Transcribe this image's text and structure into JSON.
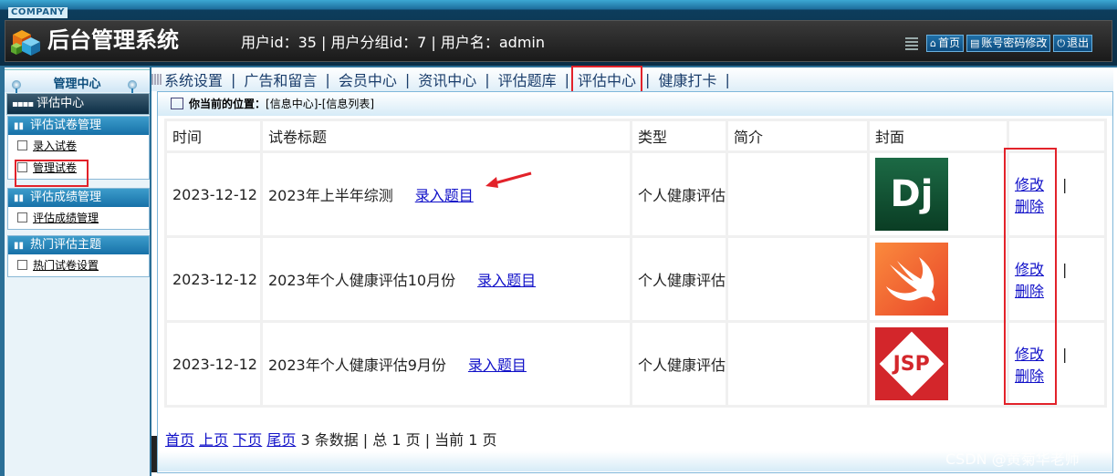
{
  "header": {
    "company": "COMPANY",
    "title": "后台管理系统",
    "user_info": "用户id：35 | 用户分组id：7 | 用户名：admin",
    "buttons": [
      {
        "label": "首页",
        "icon": "home-icon"
      },
      {
        "label": "账号密码修改",
        "icon": "list-icon"
      },
      {
        "label": "退出",
        "icon": "power-icon"
      }
    ]
  },
  "sidebar": {
    "heading": "管理中心",
    "selected": "评估中心",
    "groups": [
      {
        "title": "评估试卷管理",
        "items": [
          "录入试卷",
          "管理试卷"
        ]
      },
      {
        "title": "评估成绩管理",
        "items": [
          "评估成绩管理"
        ]
      },
      {
        "title": "热门评估主题",
        "items": [
          "热门试卷设置"
        ]
      }
    ]
  },
  "nav": [
    "系统设置",
    "广告和留言",
    "会员中心",
    "资讯中心",
    "评估题库",
    "评估中心",
    "健康打卡"
  ],
  "breadcrumb": {
    "label": "你当前的位置：",
    "path": "[信息中心]-[信息列表]"
  },
  "table": {
    "headers": [
      "时间",
      "试卷标题",
      "类型",
      "简介",
      "封面",
      ""
    ],
    "rows": [
      {
        "date": "2023-12-12",
        "title": "2023年上半年综测",
        "link": "录入题目",
        "type": "个人健康评估",
        "intro": "",
        "cover": "Dj",
        "edit": "修改",
        "delete": "删除",
        "sep": "|"
      },
      {
        "date": "2023-12-12",
        "title": "2023年个人健康评估10月份",
        "link": "录入题目",
        "type": "个人健康评估",
        "intro": "",
        "cover": "swift-logo",
        "edit": "修改",
        "delete": "删除",
        "sep": "|"
      },
      {
        "date": "2023-12-12",
        "title": "2023年个人健康评估9月份",
        "link": "录入题目",
        "type": "个人健康评估",
        "intro": "",
        "cover": "JSP",
        "edit": "修改",
        "delete": "删除",
        "sep": "|"
      }
    ]
  },
  "pager": {
    "first": "首页",
    "prev": "上页",
    "next": "下页",
    "last": "尾页",
    "summary": "3 条数据 | 总 1 页 | 当前 1 页"
  },
  "watermark": "CSDN @黄菊华老师",
  "colors": {
    "accent": "#1771a8",
    "highlight": "#e2222a",
    "link": "#1010c8"
  }
}
